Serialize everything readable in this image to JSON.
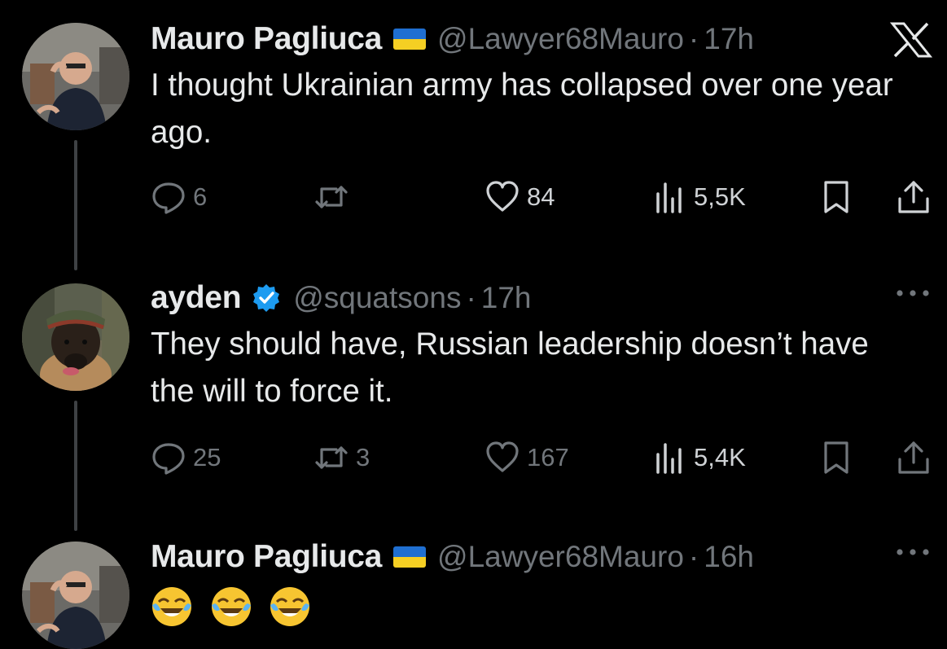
{
  "tweets": [
    {
      "name": "Mauro Pagliuca",
      "handle": "@Lawyer68Mauro",
      "separator": "·",
      "time": "17h",
      "text": "I thought Ukrainian army has collapsed over one year ago.",
      "replies": "6",
      "retweets": "",
      "likes": "84",
      "views": "5,5K"
    },
    {
      "name": "ayden",
      "handle": "@squatsons",
      "separator": "·",
      "time": "17h",
      "text": "They should have, Russian leadership doesn’t have the will to force it.",
      "replies": "25",
      "retweets": "3",
      "likes": "167",
      "views": "5,4K"
    },
    {
      "name": "Mauro Pagliuca",
      "handle": "@Lawyer68Mauro",
      "separator": "·",
      "time": "16h",
      "emojis": [
        "😂",
        "😂",
        "😂"
      ]
    }
  ],
  "icons": {
    "platform_logo": "x-logo-icon",
    "more": "more-dots-icon",
    "reply": "reply-bubble-icon",
    "retweet": "retweet-icon",
    "like": "heart-icon",
    "views": "views-bars-icon",
    "bookmark": "bookmark-icon",
    "share": "share-icon",
    "verified": "verified-badge-icon"
  },
  "colors": {
    "background": "#000000",
    "text": "#e7e9ea",
    "muted": "#71767b",
    "verified": "#1d9bf0",
    "flag_blue": "#1f6fd1",
    "flag_yellow": "#f5cf23"
  }
}
